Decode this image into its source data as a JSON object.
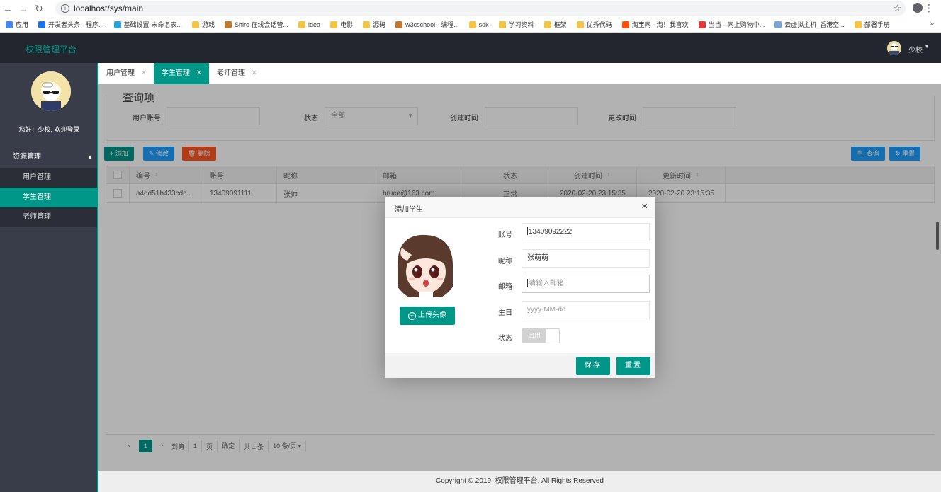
{
  "browser": {
    "url": "localhost/sys/main",
    "bookmarks": [
      {
        "label": "应用",
        "color": "#4285f4"
      },
      {
        "label": "开发者头条 - 程序...",
        "color": "#1a73e8"
      },
      {
        "label": "基础设置-未命名表...",
        "color": "#29a3e0"
      },
      {
        "label": "游戏",
        "color": "#f4c542"
      },
      {
        "label": "Shiro 在线会话管...",
        "color": "#c47a2c"
      },
      {
        "label": "idea",
        "color": "#f4c542"
      },
      {
        "label": "电影",
        "color": "#f4c542"
      },
      {
        "label": "源码",
        "color": "#f4c542"
      },
      {
        "label": "w3cschool - 编程...",
        "color": "#c47a2c"
      },
      {
        "label": "sdk",
        "color": "#f4c542"
      },
      {
        "label": "学习资料",
        "color": "#f4c542"
      },
      {
        "label": "框架",
        "color": "#f4c542"
      },
      {
        "label": "优秀代码",
        "color": "#f4c542"
      },
      {
        "label": "淘宝网 - 淘！我喜欢",
        "color": "#ff5000"
      },
      {
        "label": "当当—网上购物中...",
        "color": "#e4393c"
      },
      {
        "label": "云虚拟主机_香港空...",
        "color": "#7aa5d8"
      },
      {
        "label": "部署手册",
        "color": "#f4c542"
      }
    ],
    "more": "»"
  },
  "header": {
    "title": "权限管理平台",
    "user": "少校"
  },
  "sidebar": {
    "welcome": "您好！少校, 欢迎登录",
    "group": "资源管理",
    "items": [
      {
        "label": "用户管理"
      },
      {
        "label": "学生管理"
      },
      {
        "label": "老师管理"
      }
    ]
  },
  "tabs": [
    {
      "label": "用户管理"
    },
    {
      "label": "学生管理"
    },
    {
      "label": "老师管理"
    }
  ],
  "query": {
    "title": "查询项",
    "account_label": "用户账号",
    "status_label": "状态",
    "status_value": "全部",
    "created_label": "创建时间",
    "updated_label": "更改时间"
  },
  "toolbar": {
    "add": "+ 添加",
    "edit": "✎ 修改",
    "delete": "🗑 删除",
    "search": "🔍 查询",
    "reset": "↻ 重置"
  },
  "table": {
    "headers": [
      "编号",
      "账号",
      "昵称",
      "邮箱",
      "状态",
      "创建时间",
      "更新时间"
    ],
    "rows": [
      [
        "a4dd51b433cdc...",
        "13409091111",
        "张帅",
        "bruce@163.com",
        "正常",
        "2020-02-20 23:15:35",
        "2020-02-20 23:15:35"
      ]
    ]
  },
  "pager": {
    "prev": "‹",
    "page": "1",
    "next": "›",
    "goto_label": "到第",
    "goto_value": "1",
    "page_unit": "页",
    "confirm": "确定",
    "total": "共 1 条",
    "size": "10 条/页 ▾"
  },
  "footer": "Copyright © 2019, 权限管理平台, All Rights Reserved",
  "dialog": {
    "title": "添加学生",
    "close": "×",
    "upload": "上传头像",
    "fields": {
      "account_label": "账号",
      "account_value": "13409092222",
      "nickname_label": "昵称",
      "nickname_value": "张萌萌",
      "email_label": "邮箱",
      "email_placeholder": "请输入邮箱",
      "birthday_label": "生日",
      "birthday_placeholder": "yyyy-MM-dd",
      "status_label": "状态",
      "status_switch": "启用"
    },
    "save": "保存",
    "reset": "重置"
  }
}
